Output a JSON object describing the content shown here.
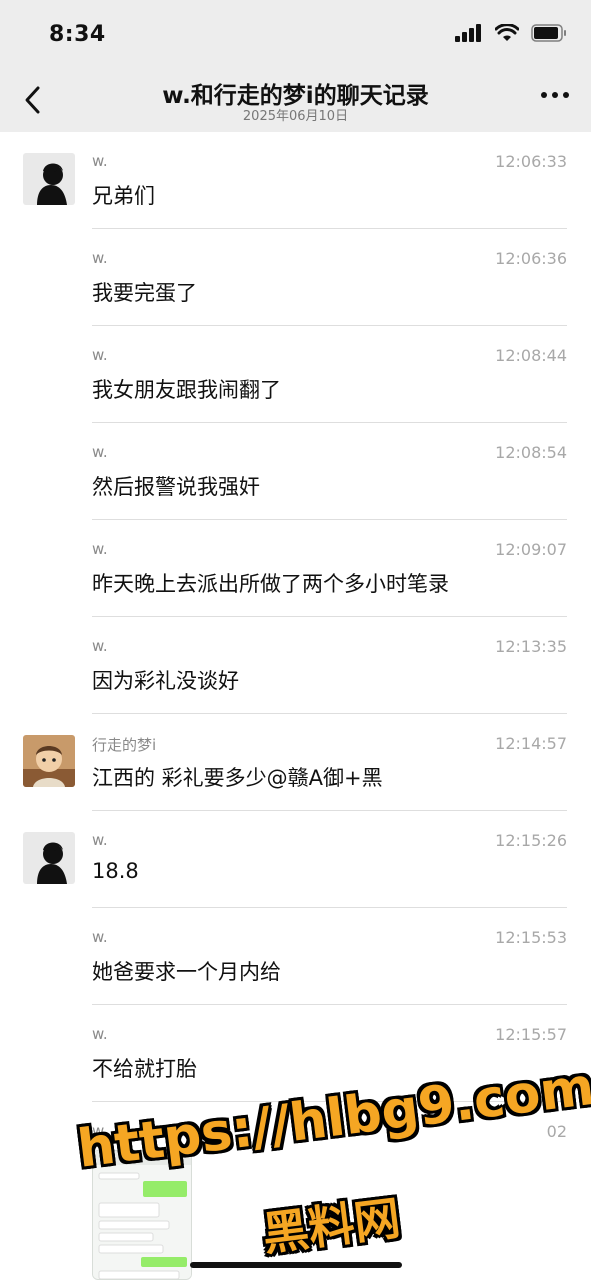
{
  "status_bar": {
    "time": "8:34",
    "icons": [
      "signal-icon",
      "wifi-icon",
      "battery-icon"
    ]
  },
  "nav": {
    "title": "w.和行走的梦i的聊天记录",
    "date": "2025年06月10日",
    "back_icon": "chevron-left-icon",
    "more_icon": "more-icon"
  },
  "messages": [
    {
      "sender": "w.",
      "time": "12:06:33",
      "text": "兄弟们",
      "avatar": "w"
    },
    {
      "sender": "w.",
      "time": "12:06:36",
      "text": "我要完蛋了",
      "avatar": ""
    },
    {
      "sender": "w.",
      "time": "12:08:44",
      "text": "我女朋友跟我闹翻了",
      "avatar": ""
    },
    {
      "sender": "w.",
      "time": "12:08:54",
      "text": "然后报警说我强奸",
      "avatar": ""
    },
    {
      "sender": "w.",
      "time": "12:09:07",
      "text": "昨天晚上去派出所做了两个多小时笔录",
      "avatar": ""
    },
    {
      "sender": "w.",
      "time": "12:13:35",
      "text": "因为彩礼没谈好",
      "avatar": ""
    },
    {
      "sender": "行走的梦i",
      "time": "12:14:57",
      "text": "江西的 彩礼要多少@赣A御+黑",
      "avatar": "dream"
    },
    {
      "sender": "w.",
      "time": "12:15:26",
      "text": "18.8",
      "avatar": "w"
    },
    {
      "sender": "w.",
      "time": "12:15:53",
      "text": "她爸要求一个月内给",
      "avatar": ""
    },
    {
      "sender": "w.",
      "time": "12:15:57",
      "text": "不给就打胎",
      "avatar": ""
    },
    {
      "sender": "w.",
      "time": "02",
      "text": "",
      "avatar": ""
    }
  ],
  "watermark": {
    "url": "https://hlbg9.com",
    "name": "黑料网"
  },
  "colors": {
    "header_bg": "#ededed",
    "meta_text": "#8a8a8a",
    "time_text": "#a8a8a8",
    "watermark": "#f5a623"
  }
}
